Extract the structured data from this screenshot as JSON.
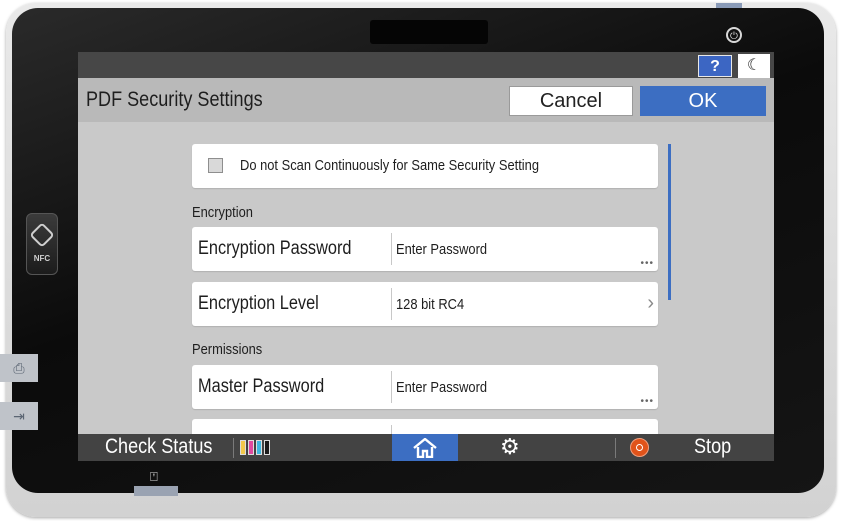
{
  "header": {
    "title": "PDF Security Settings",
    "cancel_label": "Cancel",
    "ok_label": "OK",
    "help_label": "?",
    "night_label": "☾"
  },
  "settings": {
    "continuous_checkbox": {
      "label": "Do not Scan Continuously for Same Security Setting",
      "checked": false
    },
    "encryption_section": "Encryption",
    "encryption_password": {
      "label": "Encryption Password",
      "value": "Enter Password"
    },
    "encryption_level": {
      "label": "Encryption Level",
      "value": "128 bit RC4"
    },
    "permissions_section": "Permissions",
    "master_password": {
      "label": "Master Password",
      "value": "Enter Password"
    }
  },
  "footer": {
    "check_status_label": "Check Status",
    "stop_label": "Stop",
    "toner_colors": [
      "#f2c84b",
      "#e04aa0",
      "#3fb8e0",
      "#1a1a1a"
    ]
  },
  "icons": {
    "help": "question-icon",
    "night": "moon-icon",
    "home": "home-icon",
    "settings": "gear-icon",
    "stop": "stop-icon",
    "power": "power-icon",
    "nfc": "nfc-icon"
  },
  "colors": {
    "accent": "#3c6ec2",
    "stop": "#e0531a",
    "screen_bg": "#c9c9c9"
  },
  "device": {
    "nfc_label": "NFC"
  }
}
